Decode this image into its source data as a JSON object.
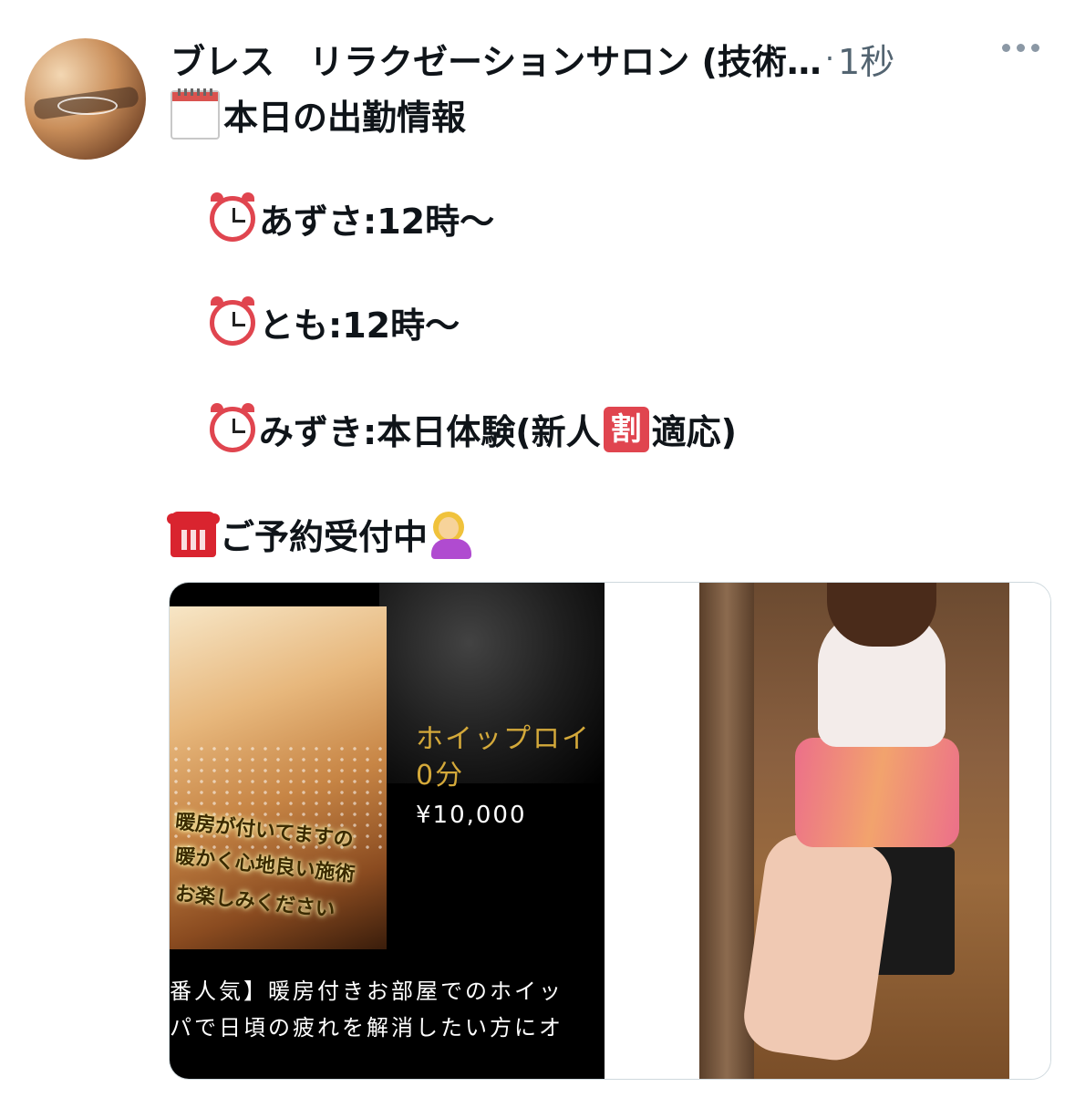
{
  "tweet": {
    "author_name": "ブレス　リラクゼーションサロン (技術…",
    "separator": "·",
    "time": "1秒",
    "lines": {
      "title": "本日の出勤情報",
      "shift1": "あずさ:12時〜",
      "shift2": "とも:12時〜",
      "shift3_pre": "みずき:本日体験(新人",
      "shift3_badge": "割",
      "shift3_post": "適応)",
      "reserve": "ご予約受付中"
    },
    "icons": {
      "calendar": "calendar-icon",
      "clock": "alarm-clock-icon",
      "phone": "telephone-icon",
      "woman": "woman-tipping-hand-icon",
      "more": "more-options-icon"
    }
  },
  "card": {
    "image_text": [
      "暖房が付いてますの",
      "暖かく心地良い施術",
      "お楽しみください"
    ],
    "menu_title_1": "ホイップロイ",
    "menu_title_2": "0分",
    "price": "¥10,000",
    "desc_1": "番人気】暖房付きお部屋でのホイッ",
    "desc_2": "パで日頃の疲れを解消したい方にオ"
  },
  "colors": {
    "text": "#0f1419",
    "muted": "#536471",
    "gold": "#d4a93a",
    "badge_red": "#e0454f"
  }
}
